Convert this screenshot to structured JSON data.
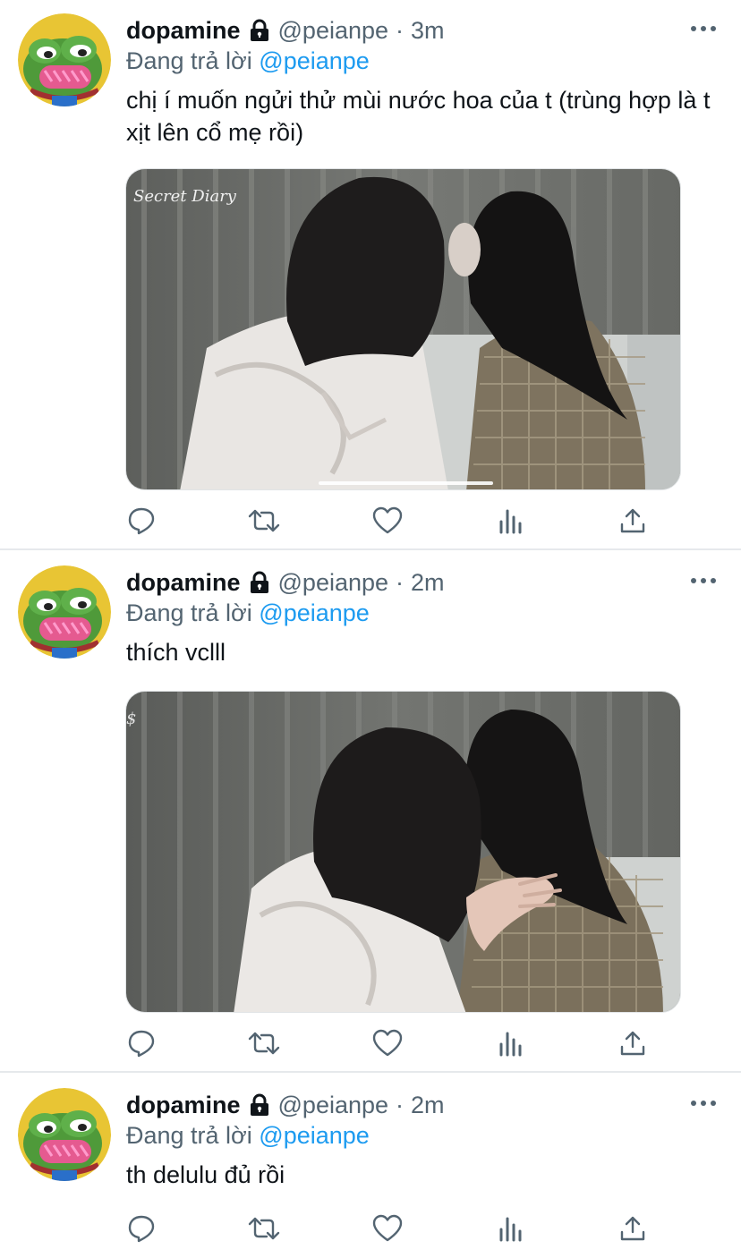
{
  "tweets": [
    {
      "name": "dopamine",
      "handle": "@peianpe",
      "separator": "·",
      "time": "3m",
      "replying_prefix": "Đang trả lời",
      "replying_to": "@peianpe",
      "text": "chị í muốn ngửi thử mùi nước hoa của t (trùng hợp là t xịt lên cổ mẹ rồi)",
      "has_media": true,
      "media_watermark": "Secret Diary"
    },
    {
      "name": "dopamine",
      "handle": "@peianpe",
      "separator": "·",
      "time": "2m",
      "replying_prefix": "Đang trả lời",
      "replying_to": "@peianpe",
      "text": "thích vclll",
      "has_media": true
    },
    {
      "name": "dopamine",
      "handle": "@peianpe",
      "separator": "·",
      "time": "2m",
      "replying_prefix": "Đang trả lời",
      "replying_to": "@peianpe",
      "text": "th delulu đủ rồi",
      "has_media": false
    }
  ],
  "icons": {
    "lock": "lock-icon",
    "more": "more-icon",
    "reply": "reply-icon",
    "retweet": "retweet-icon",
    "like": "like-icon",
    "views": "views-icon",
    "share": "share-icon"
  },
  "colors": {
    "text": "#0f1419",
    "secondary": "#536471",
    "mention": "#1d9bf0",
    "divider": "#e6e9ec"
  }
}
